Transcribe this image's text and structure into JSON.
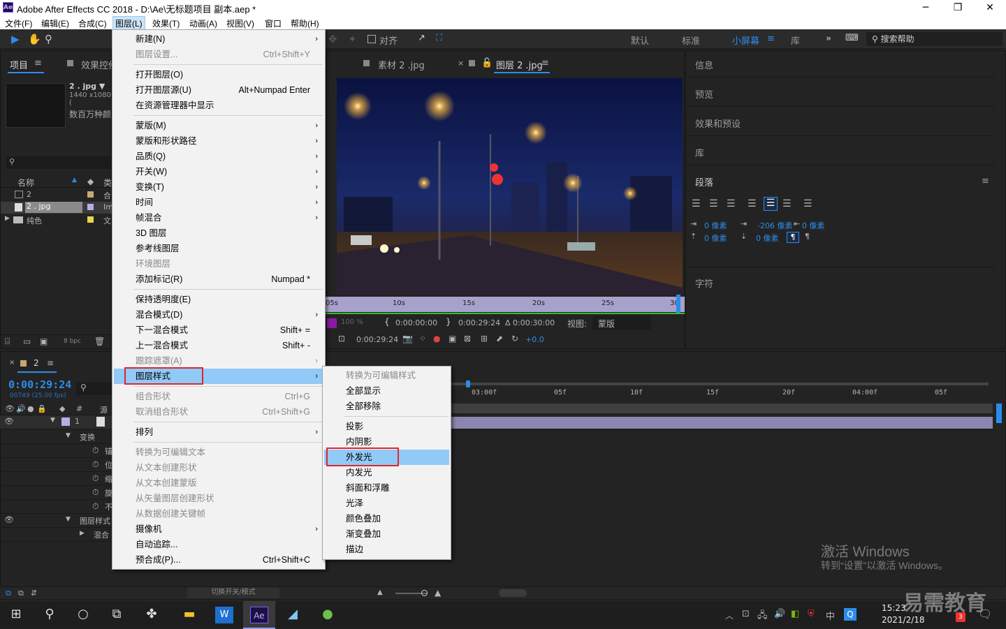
{
  "titlebar": {
    "logo": "Ae",
    "title": "Adobe After Effects CC 2018 - D:\\Ae\\无标题项目 副本.aep *",
    "minimize": "─",
    "maximize": "❐",
    "close": "✕"
  },
  "menubar": [
    "文件(F)",
    "编辑(E)",
    "合成(C)",
    "图层(L)",
    "效果(T)",
    "动画(A)",
    "视图(V)",
    "窗口",
    "帮助(H)"
  ],
  "toolbar": {
    "snap_label": "对齐",
    "workspaces": [
      "默认",
      "标准",
      "小屏幕",
      "库"
    ],
    "workspace_more": "»",
    "search_placeholder": "搜索帮助"
  },
  "project_panel": {
    "tabs": [
      "项目",
      "效果控件"
    ],
    "tab_menu": "≡",
    "preview_name": "2 . jpg ▼",
    "preview_dims": "1440 x1080 (",
    "preview_colors": "数百万种颜",
    "col_name": "名称",
    "col_type": "类",
    "items": [
      {
        "name": "2",
        "type": "合"
      },
      {
        "name": "2 . jpg",
        "type": "Im"
      },
      {
        "name": "纯色",
        "type": "文"
      }
    ],
    "bpc": "8 bpc"
  },
  "viewer": {
    "tabs": [
      "素材 2 .jpg",
      "图层 2 .jpg"
    ],
    "tab_menu": "≡",
    "ruler_ticks": [
      "05s",
      "10s",
      "15s",
      "20s",
      "25s",
      "30"
    ],
    "opacity": "100 %",
    "time_in": "0:00:00:00",
    "time_out": "0:00:29:24",
    "duration": "Δ 0:00:30:00",
    "view_label": "视图:",
    "view_value": "蒙版",
    "current_time": "0:00:29:24",
    "exposure": "+0.0"
  },
  "right_panels": {
    "info": "信息",
    "preview": "预览",
    "effects_presets": "效果和预设",
    "library": "库",
    "paragraph": "段落",
    "paragraph_menu": "≡",
    "indent_left": "0 像素",
    "indent_first": "-206 像素",
    "indent_right": "0 像素",
    "space_before": "0 像素",
    "space_after": "0 像素",
    "character": "字符"
  },
  "timeline": {
    "comp_name": "2",
    "timecode": "0:00:29:24",
    "frame_info": "00749 (25.00 fps)",
    "col_source": "源名",
    "col_hash": "#",
    "layer_index": "1",
    "transform": "变换",
    "props": [
      "锚",
      "位",
      "缩",
      "旋",
      "不"
    ],
    "layer_styles": "图层样式",
    "blend": "混合",
    "ruler": [
      "03:00f",
      "05f",
      "10f",
      "15f",
      "20f",
      "04:00f",
      "05f"
    ],
    "toggle_label": "切换开关/模式"
  },
  "layer_menu": {
    "items": [
      {
        "label": "新建(N)",
        "shortcut": "",
        "sub": true,
        "disabled": false
      },
      {
        "label": "图层设置...",
        "shortcut": "Ctrl+Shift+Y",
        "sub": false,
        "disabled": true
      },
      {
        "label": "打开图层(O)",
        "shortcut": "",
        "sub": false,
        "disabled": false
      },
      {
        "label": "打开图层源(U)",
        "shortcut": "Alt+Numpad Enter",
        "sub": false,
        "disabled": false
      },
      {
        "label": "在资源管理器中显示",
        "shortcut": "",
        "sub": false,
        "disabled": false
      },
      {
        "label": "蒙版(M)",
        "shortcut": "",
        "sub": true,
        "disabled": false
      },
      {
        "label": "蒙版和形状路径",
        "shortcut": "",
        "sub": true,
        "disabled": false
      },
      {
        "label": "品质(Q)",
        "shortcut": "",
        "sub": true,
        "disabled": false
      },
      {
        "label": "开关(W)",
        "shortcut": "",
        "sub": true,
        "disabled": false
      },
      {
        "label": "变换(T)",
        "shortcut": "",
        "sub": true,
        "disabled": false
      },
      {
        "label": "时间",
        "shortcut": "",
        "sub": true,
        "disabled": false
      },
      {
        "label": "帧混合",
        "shortcut": "",
        "sub": true,
        "disabled": false
      },
      {
        "label": "3D 图层",
        "shortcut": "",
        "sub": false,
        "disabled": false
      },
      {
        "label": "参考线图层",
        "shortcut": "",
        "sub": false,
        "disabled": false
      },
      {
        "label": "环境图层",
        "shortcut": "",
        "sub": false,
        "disabled": true
      },
      {
        "label": "添加标记(R)",
        "shortcut": "Numpad *",
        "sub": false,
        "disabled": false
      },
      {
        "label": "保持透明度(E)",
        "shortcut": "",
        "sub": false,
        "disabled": false
      },
      {
        "label": "混合模式(D)",
        "shortcut": "",
        "sub": true,
        "disabled": false
      },
      {
        "label": "下一混合模式",
        "shortcut": "Shift+ =",
        "sub": false,
        "disabled": false
      },
      {
        "label": "上一混合模式",
        "shortcut": "Shift+ -",
        "sub": false,
        "disabled": false
      },
      {
        "label": "跟踪遮罩(A)",
        "shortcut": "",
        "sub": true,
        "disabled": true
      },
      {
        "label": "图层样式",
        "shortcut": "",
        "sub": true,
        "disabled": false,
        "highlight": true
      },
      {
        "label": "组合形状",
        "shortcut": "Ctrl+G",
        "sub": false,
        "disabled": true
      },
      {
        "label": "取消组合形状",
        "shortcut": "Ctrl+Shift+G",
        "sub": false,
        "disabled": true
      },
      {
        "label": "排列",
        "shortcut": "",
        "sub": true,
        "disabled": false
      },
      {
        "label": "转换为可编辑文本",
        "shortcut": "",
        "sub": false,
        "disabled": true
      },
      {
        "label": "从文本创建形状",
        "shortcut": "",
        "sub": false,
        "disabled": true
      },
      {
        "label": "从文本创建蒙版",
        "shortcut": "",
        "sub": false,
        "disabled": true
      },
      {
        "label": "从矢量图层创建形状",
        "shortcut": "",
        "sub": false,
        "disabled": true
      },
      {
        "label": "从数据创建关键帧",
        "shortcut": "",
        "sub": false,
        "disabled": true
      },
      {
        "label": "摄像机",
        "shortcut": "",
        "sub": true,
        "disabled": false
      },
      {
        "label": "自动追踪...",
        "shortcut": "",
        "sub": false,
        "disabled": false
      },
      {
        "label": "预合成(P)...",
        "shortcut": "Ctrl+Shift+C",
        "sub": false,
        "disabled": false
      }
    ]
  },
  "style_submenu": {
    "items": [
      {
        "label": "转换为可编辑样式",
        "disabled": true
      },
      {
        "label": "全部显示",
        "disabled": false
      },
      {
        "label": "全部移除",
        "disabled": false
      },
      {
        "label": "投影",
        "disabled": false
      },
      {
        "label": "内阴影",
        "disabled": false
      },
      {
        "label": "外发光",
        "disabled": false,
        "highlight": true
      },
      {
        "label": "内发光",
        "disabled": false
      },
      {
        "label": "斜面和浮雕",
        "disabled": false
      },
      {
        "label": "光泽",
        "disabled": false
      },
      {
        "label": "颜色叠加",
        "disabled": false
      },
      {
        "label": "渐变叠加",
        "disabled": false
      },
      {
        "label": "描边",
        "disabled": false
      }
    ]
  },
  "watermark": {
    "line1": "激活 Windows",
    "line2": "转到“设置”以激活 Windows。",
    "brand": "易需教育"
  },
  "taskbar": {
    "time": "15:23",
    "date": "2021/2/18",
    "ime": "中",
    "notif_badge": "3"
  },
  "colors": {
    "accent": "#2d8ceb",
    "menu_highlight": "#91c9f7",
    "callout_red": "#e0262b",
    "timeline_bar": "#8a86b0"
  }
}
